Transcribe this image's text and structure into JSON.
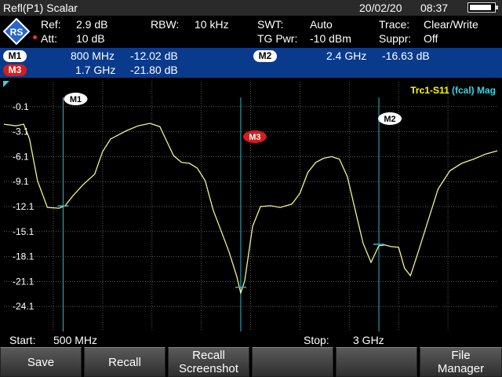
{
  "titlebar": {
    "title": "Refl(P1) Scalar",
    "date": "20/02/20",
    "time": "08:37",
    "battery_level": 0.9
  },
  "setup": {
    "ref_label": "Ref:",
    "ref_value": "2.9 dB",
    "att_label": "Att:",
    "att_value": "10 dB",
    "rbw_label": "RBW:",
    "rbw_value": "10 kHz",
    "swt_label": "SWT:",
    "swt_value": "Auto",
    "tgpwr_label": "TG Pwr:",
    "tgpwr_value": "-10 dBm",
    "trace_label": "Trace:",
    "trace_value": "Clear/Write",
    "suppr_label": "Suppr:",
    "suppr_value": "Off"
  },
  "markers": {
    "m1": {
      "label": "M1",
      "freq": "800 MHz",
      "value": "-12.02 dB"
    },
    "m2": {
      "label": "M2",
      "freq": "2.4 GHz",
      "value": "-16.63 dB"
    },
    "m3": {
      "label": "M3",
      "freq": "1.7 GHz",
      "value": "-21.80 dB"
    }
  },
  "trace_legend": {
    "name": "Trc1-S11",
    "cal": "(fcal)",
    "format": "Mag"
  },
  "colors": {
    "background": "#000000",
    "trace": "#f2f28a",
    "marker_line": "#2fb6c6",
    "grid": "#5a5a5a",
    "marker_bar": "#0a3a8c",
    "legend_yellow": "#ffff00",
    "legend_cyan": "#2fd6e6",
    "m3_badge": "#d61c1c"
  },
  "footer": {
    "start_label": "Start:",
    "start_value": "500 MHz",
    "stop_label": "Stop:",
    "stop_value": "3 GHz"
  },
  "softkeys": [
    "Save",
    "Recall",
    "Recall\nScreenshot",
    "",
    "",
    "File\nManager"
  ],
  "chart_data": {
    "type": "line",
    "y_ticks": [
      "-0.1",
      "-3.1",
      "-6.1",
      "-9.1",
      "-12.1",
      "-15.1",
      "-18.1",
      "-21.1",
      "-24.1"
    ],
    "ylim": [
      -27.1,
      2.9
    ],
    "xlim_mhz": [
      500,
      3000
    ],
    "grid": true,
    "series": [
      {
        "name": "Trc1-S11",
        "x_mhz": [
          500,
          560,
          600,
          630,
          670,
          720,
          780,
          810,
          850,
          900,
          960,
          1000,
          1040,
          1080,
          1120,
          1180,
          1240,
          1290,
          1320,
          1360,
          1400,
          1440,
          1480,
          1520,
          1560,
          1600,
          1640,
          1680,
          1700,
          1720,
          1760,
          1800,
          1850,
          1900,
          1960,
          2000,
          2040,
          2080,
          2120,
          2160,
          2200,
          2240,
          2280,
          2320,
          2360,
          2400,
          2430,
          2460,
          2500,
          2530,
          2560,
          2600,
          2640,
          2700,
          2760,
          2820,
          2880,
          2940,
          3000
        ],
        "y_db": [
          -2.2,
          -2.4,
          -2.2,
          -4.0,
          -9.0,
          -12.2,
          -12.3,
          -12.0,
          -10.8,
          -9.5,
          -8.2,
          -5.5,
          -4.0,
          -3.5,
          -3.0,
          -2.4,
          -2.1,
          -2.5,
          -4.0,
          -6.0,
          -6.8,
          -6.9,
          -7.5,
          -9.0,
          -12.5,
          -15.0,
          -17.5,
          -20.5,
          -22.5,
          -21.0,
          -14.5,
          -12.1,
          -12.0,
          -12.2,
          -11.8,
          -10.5,
          -8.0,
          -6.8,
          -6.3,
          -6.1,
          -6.4,
          -8.5,
          -12.5,
          -16.5,
          -18.8,
          -16.8,
          -16.7,
          -16.9,
          -17.0,
          -19.5,
          -20.4,
          -17.5,
          -14.5,
          -10.0,
          -7.8,
          -6.9,
          -6.4,
          -5.8,
          -5.4
        ]
      }
    ],
    "markers": [
      {
        "name": "M1",
        "x_mhz": 800,
        "y_db": -12.02
      },
      {
        "name": "M2",
        "x_mhz": 2400,
        "y_db": -16.63
      },
      {
        "name": "M3",
        "x_mhz": 1700,
        "y_db": -21.8
      }
    ]
  }
}
